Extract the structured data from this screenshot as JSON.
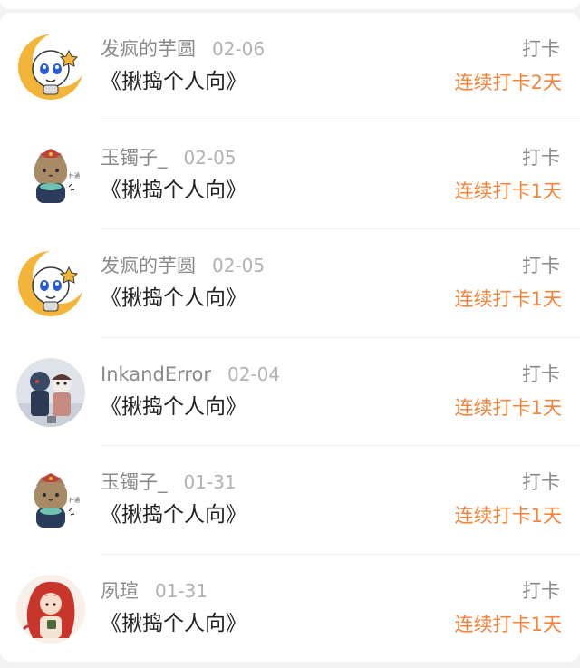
{
  "checkins": [
    {
      "user": "发疯的芋圆",
      "date": "02-06",
      "title": "《揪捣个人向》",
      "type": "打卡",
      "streak": "连续打卡2天",
      "avatar": "moon-character-avatar"
    },
    {
      "user": "玉镯子_",
      "date": "02-05",
      "title": "《揪捣个人向》",
      "type": "打卡",
      "streak": "连续打卡1天",
      "avatar": "cat-avatar"
    },
    {
      "user": "发疯的芋圆",
      "date": "02-05",
      "title": "《揪捣个人向》",
      "type": "打卡",
      "streak": "连续打卡1天",
      "avatar": "moon-character-avatar"
    },
    {
      "user": "InkandError",
      "date": "02-04",
      "title": "《揪捣个人向》",
      "type": "打卡",
      "streak": "连续打卡1天",
      "avatar": "two-characters-avatar"
    },
    {
      "user": "玉镯子_",
      "date": "01-31",
      "title": "《揪捣个人向》",
      "type": "打卡",
      "streak": "连续打卡1天",
      "avatar": "cat-avatar"
    },
    {
      "user": "夙瑄",
      "date": "01-31",
      "title": "《揪捣个人向》",
      "type": "打卡",
      "streak": "连续打卡1天",
      "avatar": "red-hair-character-avatar"
    }
  ],
  "colors": {
    "accent": "#f5843b",
    "username": "#8a8a8a",
    "date": "#b2b2b2",
    "title": "#222222"
  }
}
